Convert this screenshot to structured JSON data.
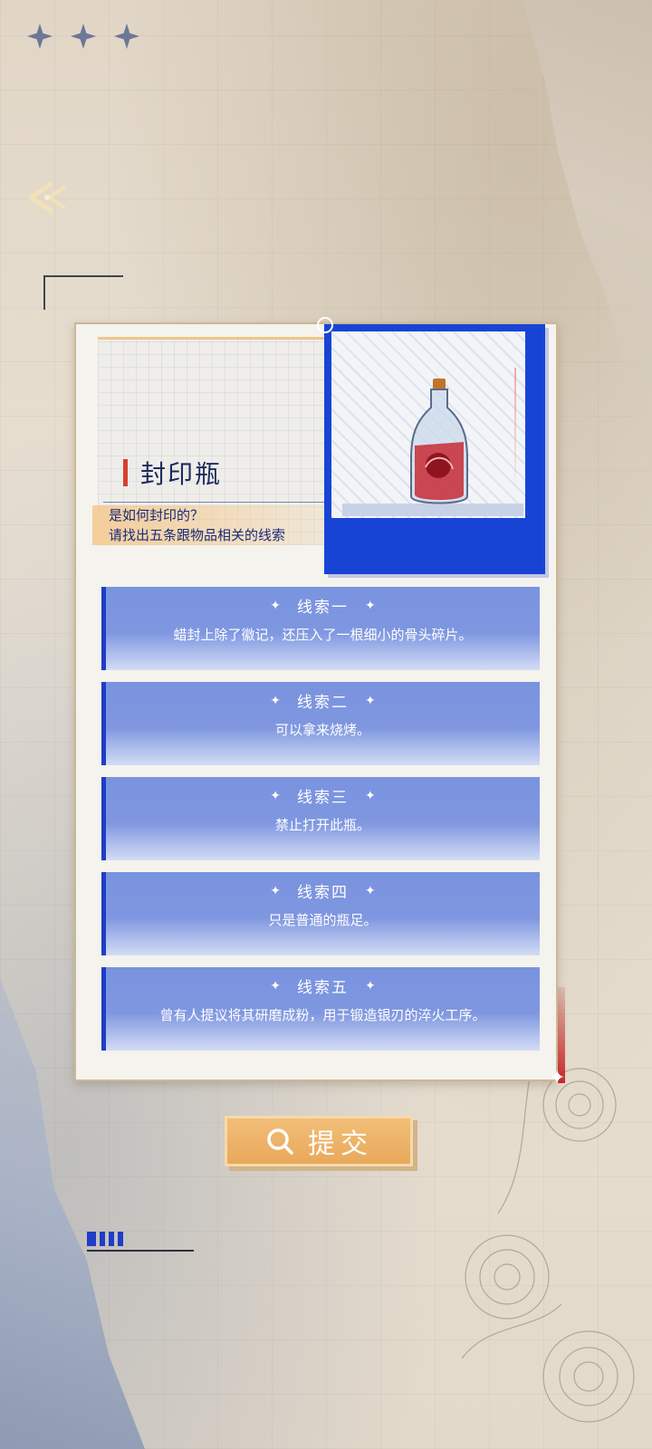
{
  "item": {
    "title": "封印瓶",
    "description_lines": [
      "是如何封印的？",
      "请找出五条跟物品相关的线索"
    ]
  },
  "clues": [
    {
      "title": "线索一",
      "text": "蜡封上除了徽记，还压入了一根细小的骨头碎片。"
    },
    {
      "title": "线索二",
      "text": "可以拿来烧烤。"
    },
    {
      "title": "线索三",
      "text": "禁止打开此瓶。"
    },
    {
      "title": "线索四",
      "text": "只是普通的瓶足。"
    },
    {
      "title": "线索五",
      "text": "曾有人提议将其研磨成粉，用于锻造银刃的淬火工序。"
    }
  ],
  "submit": {
    "label": "提交",
    "icon": "search-icon"
  },
  "colors": {
    "accent_blue": "#1844d6",
    "clue_blue": "#7a93df",
    "accent_red": "#d64030",
    "button_orange": "#e9a95b",
    "title_navy": "#1d2a5e"
  }
}
